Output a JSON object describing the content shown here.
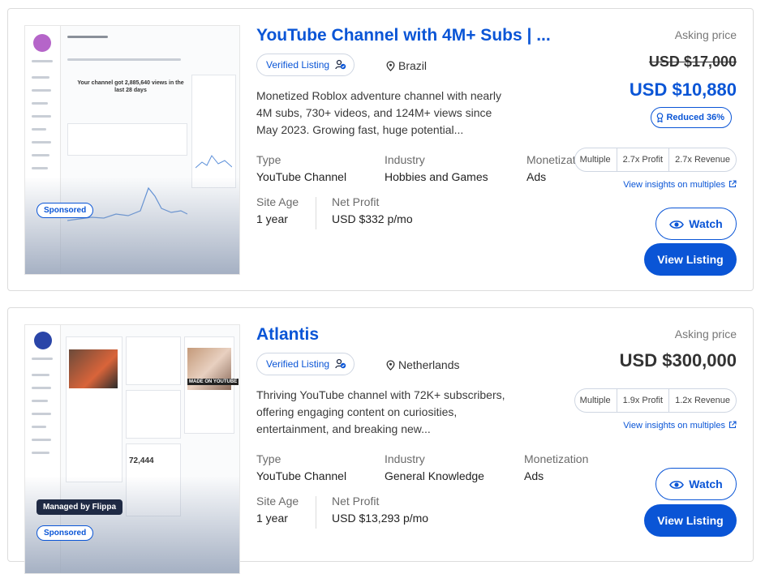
{
  "listings": [
    {
      "title": "YouTube Channel with 4M+ Subs | ...",
      "verified_label": "Verified Listing",
      "location": "Brazil",
      "description": "Monetized Roblox adventure channel with nearly 4M subs, 730+ videos, and 124M+ views since May 2023. Growing fast, huge potential...",
      "type_label": "Type",
      "type_value": "YouTube Channel",
      "industry_label": "Industry",
      "industry_value": "Hobbies and Games",
      "monetization_label": "Monetization",
      "monetization_value": "Ads",
      "site_age_label": "Site Age",
      "site_age_value": "1 year",
      "net_profit_label": "Net Profit",
      "net_profit_value": "USD $332 p/mo",
      "asking_label": "Asking price",
      "original_price": "USD $17,000",
      "price": "USD $10,880",
      "reduced_label": "Reduced 36%",
      "multiples": [
        "Multiple",
        "2.7x Profit",
        "2.7x Revenue"
      ],
      "insights_link": "View insights on multiples",
      "watch_label": "Watch",
      "view_label": "View Listing",
      "sponsored_label": "Sponsored",
      "thumb_heading": "Your channel got 2,885,640 views in the last 28 days"
    },
    {
      "title": "Atlantis",
      "verified_label": "Verified Listing",
      "location": "Netherlands",
      "description": "Thriving YouTube channel with 72K+ subscribers, offering engaging content on curiosities, entertainment, and breaking new...",
      "type_label": "Type",
      "type_value": "YouTube Channel",
      "industry_label": "Industry",
      "industry_value": "General Knowledge",
      "monetization_label": "Monetization",
      "monetization_value": "Ads",
      "site_age_label": "Site Age",
      "site_age_value": "1 year",
      "net_profit_label": "Net Profit",
      "net_profit_value": "USD $13,293 p/mo",
      "asking_label": "Asking price",
      "price": "USD $300,000",
      "multiples": [
        "Multiple",
        "1.9x Profit",
        "1.2x Revenue"
      ],
      "insights_link": "View insights on multiples",
      "watch_label": "Watch",
      "view_label": "View Listing",
      "managed_label": "Managed by Flippa",
      "sponsored_label": "Sponsored",
      "thumb_badge": "MADE ON YOUTUBE",
      "thumb_stat": "72,444"
    }
  ],
  "colors": {
    "brand": "#0a55d6",
    "text": "#2b2b2b",
    "muted": "#6b6b6b",
    "border": "#dcdcdc"
  }
}
